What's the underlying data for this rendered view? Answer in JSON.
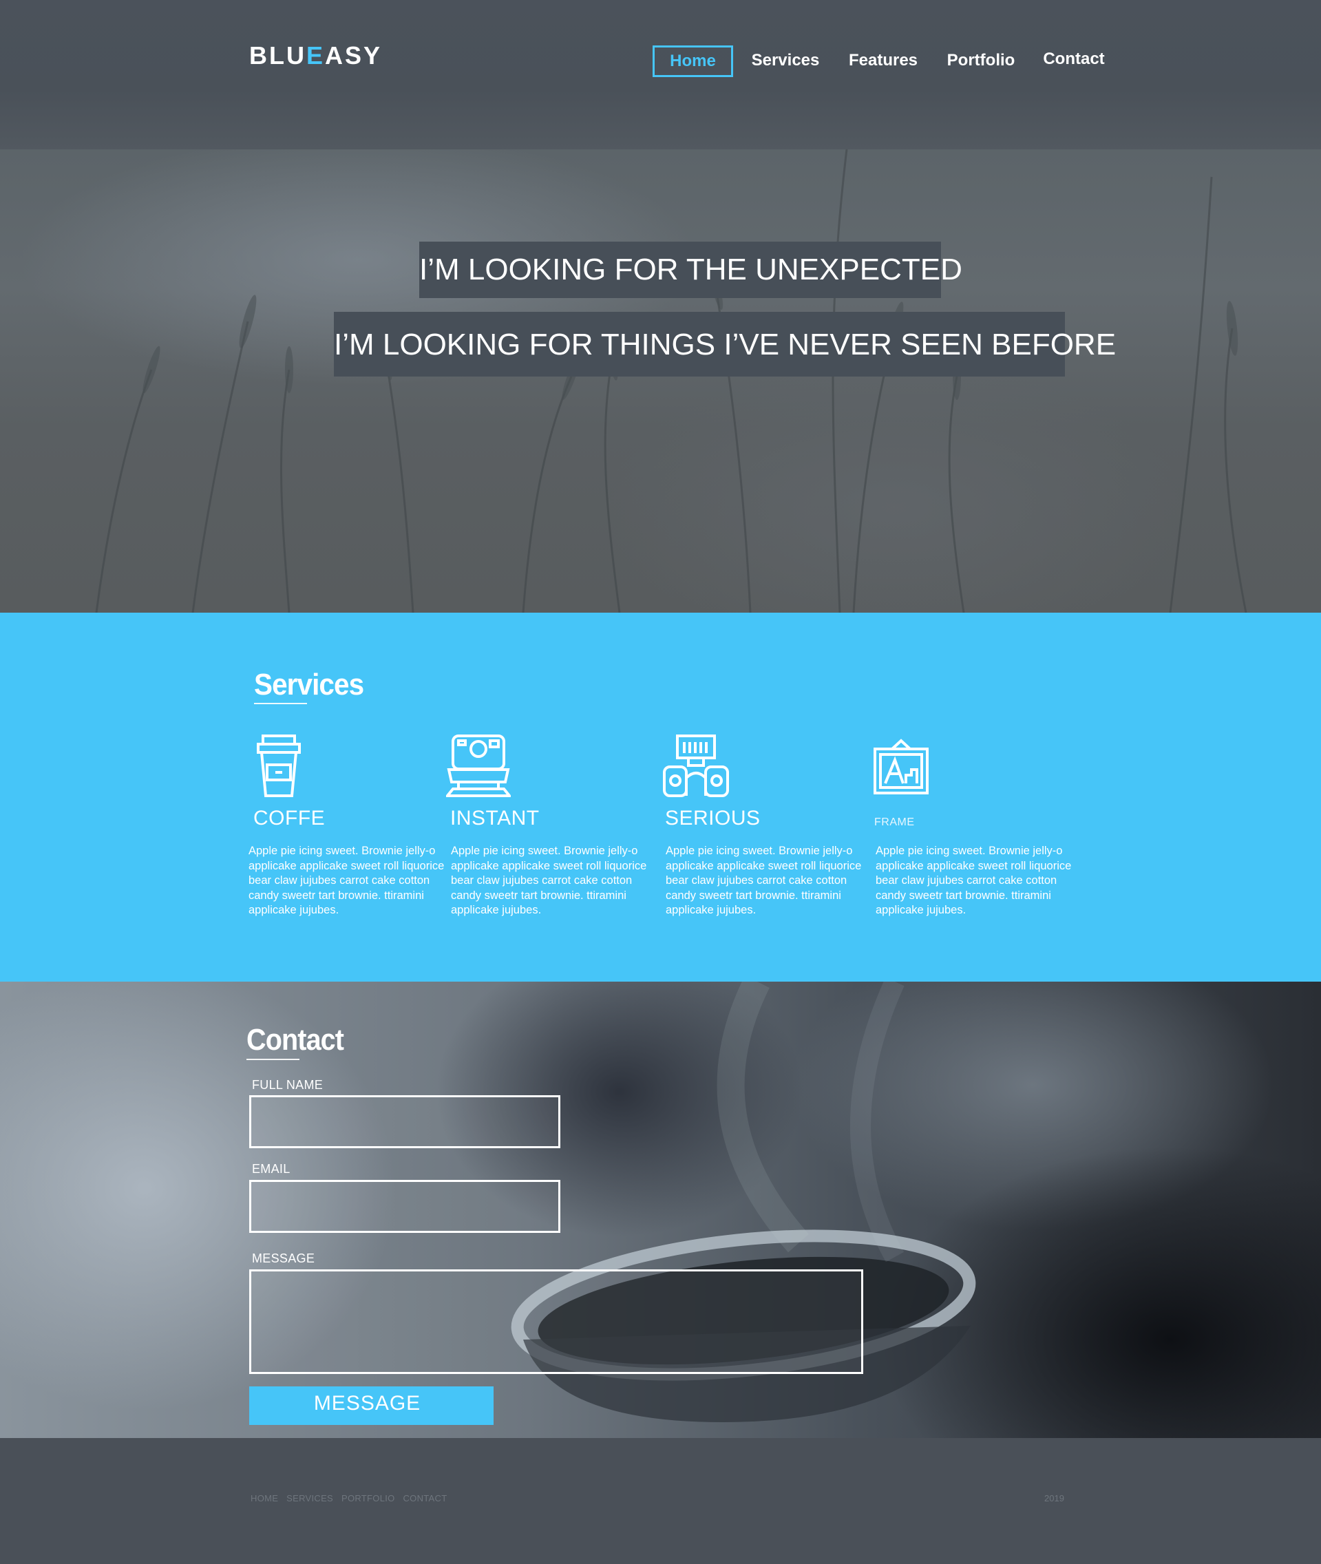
{
  "brand": {
    "prefix": "BLU",
    "accent": "E",
    "suffix": "ASY"
  },
  "nav": {
    "items": [
      {
        "label": "Home",
        "active": true
      },
      {
        "label": "Services"
      },
      {
        "label": "Features"
      },
      {
        "label": "Portfolio"
      },
      {
        "label": "Contact"
      }
    ]
  },
  "hero": {
    "headline_1": "I’M LOOKING FOR THE UNEXPECTED",
    "headline_2": "I’M LOOKING FOR THINGS I’VE NEVER SEEN BEFORE"
  },
  "services": {
    "title": "Services",
    "items": [
      {
        "icon": "coffee-cup-icon",
        "title": "COFFE",
        "text": "Apple pie icing sweet. Brownie jelly-o applicake  applicake sweet roll liquorice bear claw jujubes carrot cake cotton candy sweetr tart brownie. ttiramini applicake jujubes."
      },
      {
        "icon": "instant-camera-icon",
        "title": "INSTANT",
        "text": "Apple pie icing sweet. Brownie jelly-o applicake  applicake sweet roll liquorice bear claw jujubes carrot cake cotton candy sweetr tart brownie. ttiramini applicake jujubes."
      },
      {
        "icon": "vintage-camera-icon",
        "title": "SERIOUS",
        "text": "Apple pie icing sweet. Brownie jelly-o applicake  applicake sweet roll liquorice bear claw jujubes carrot cake cotton candy sweetr tart brownie. ttiramini applicake jujubes."
      },
      {
        "icon": "picture-frame-icon",
        "title": "FRAME",
        "text": "Apple pie icing sweet. Brownie jelly-o applicake  applicake sweet roll liquorice bear claw jujubes carrot cake cotton candy sweetr tart brownie. ttiramini applicake jujubes."
      }
    ]
  },
  "contact": {
    "title": "Contact",
    "full_name_label": "FULL NAME",
    "full_name_value": "",
    "email_label": "EMAIL",
    "email_value": "",
    "message_label": "MESSAGE",
    "message_value": "",
    "submit_label": "MESSAGE"
  },
  "footer": {
    "links": [
      "HOME",
      "SERVICES",
      "PORTFOLIO",
      "CONTACT"
    ],
    "year": "2019"
  },
  "colors": {
    "accent": "#46c5f8",
    "dark": "#4a5058",
    "headline_bg": "#474f58"
  }
}
